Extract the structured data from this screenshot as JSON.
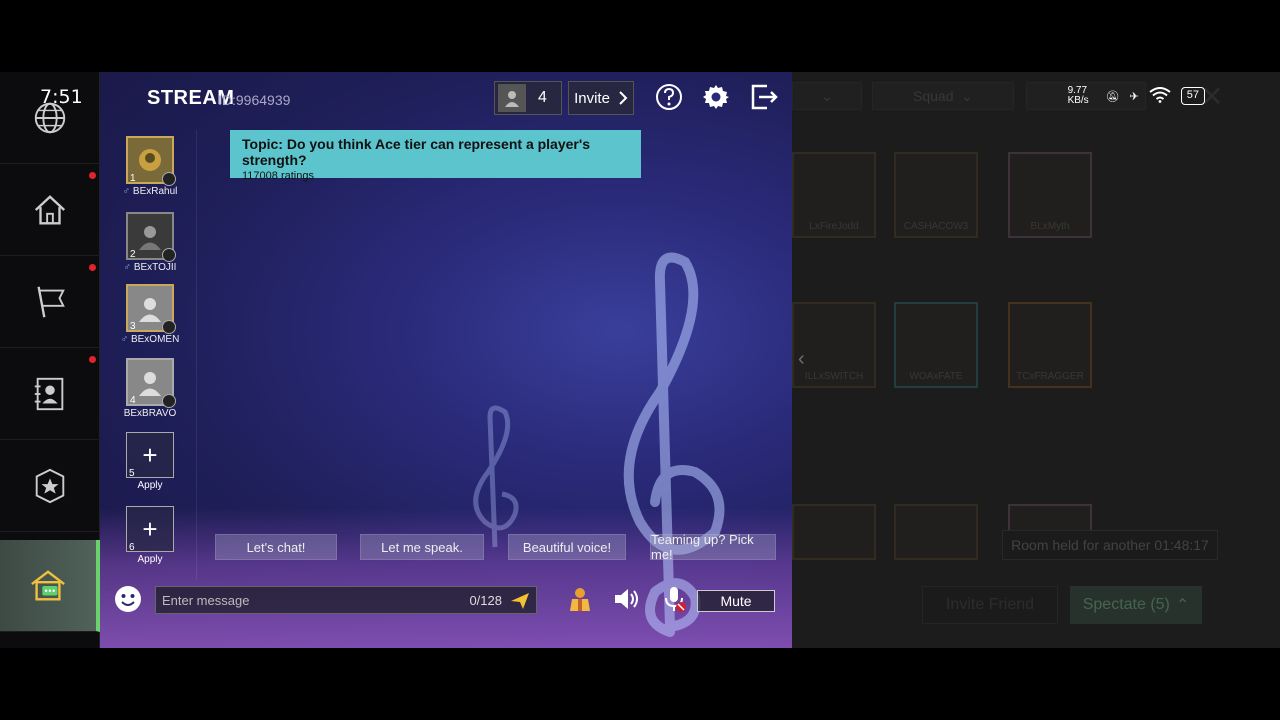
{
  "status_bar": {
    "time": "7:51",
    "network_speed": "9.77 KB/s",
    "battery": "57"
  },
  "left_nav": {
    "items": [
      {
        "name": "globe",
        "badge": false
      },
      {
        "name": "home",
        "badge": true
      },
      {
        "name": "flag",
        "badge": true
      },
      {
        "name": "contacts",
        "badge": true
      },
      {
        "name": "rank-badge",
        "badge": false
      },
      {
        "name": "chat-room",
        "active": true
      }
    ]
  },
  "header": {
    "title": "STREAM",
    "room_id": "ID:9964939",
    "member_count": "4",
    "invite_label": "Invite"
  },
  "topic": {
    "text": "Topic: Do you think Ace tier can represent a player's strength?",
    "ratings": "117008 ratings"
  },
  "seats": [
    {
      "number": "1",
      "name": "BExRahul",
      "gender": "♂"
    },
    {
      "number": "2",
      "name": "BExTOJII",
      "gender": "♂"
    },
    {
      "number": "3",
      "name": "BExOMEN",
      "gender": "♂"
    },
    {
      "number": "4",
      "name": "BExBRAVO",
      "gender": ""
    },
    {
      "number": "5",
      "name": "Apply",
      "gender": ""
    },
    {
      "number": "6",
      "name": "Apply",
      "gender": ""
    }
  ],
  "quick_phrases": [
    "Let's chat!",
    "Let me speak.",
    "Beautiful voice!",
    "Teaming up? Pick me!"
  ],
  "message_bar": {
    "placeholder": "Enter message",
    "char_count": "0/128",
    "mute_label": "Mute"
  },
  "right_panel": {
    "dropdown_mode": "Squad",
    "room_cards": [
      "LxFireJodd",
      "CASHACOW3",
      "BLxMyth",
      "ILLxSWITCH",
      "WOAxFATE",
      "TCxFRAGGER",
      "",
      "",
      ""
    ],
    "held_text": "Room held for another 01:48:17",
    "invite_friend_label": "Invite Friend",
    "spectate_label": "Spectate (5)"
  },
  "colors": {
    "topic_bg": "#5bc4cd",
    "panel_bg": "#2a2a7a",
    "active_nav": "#50625a"
  }
}
